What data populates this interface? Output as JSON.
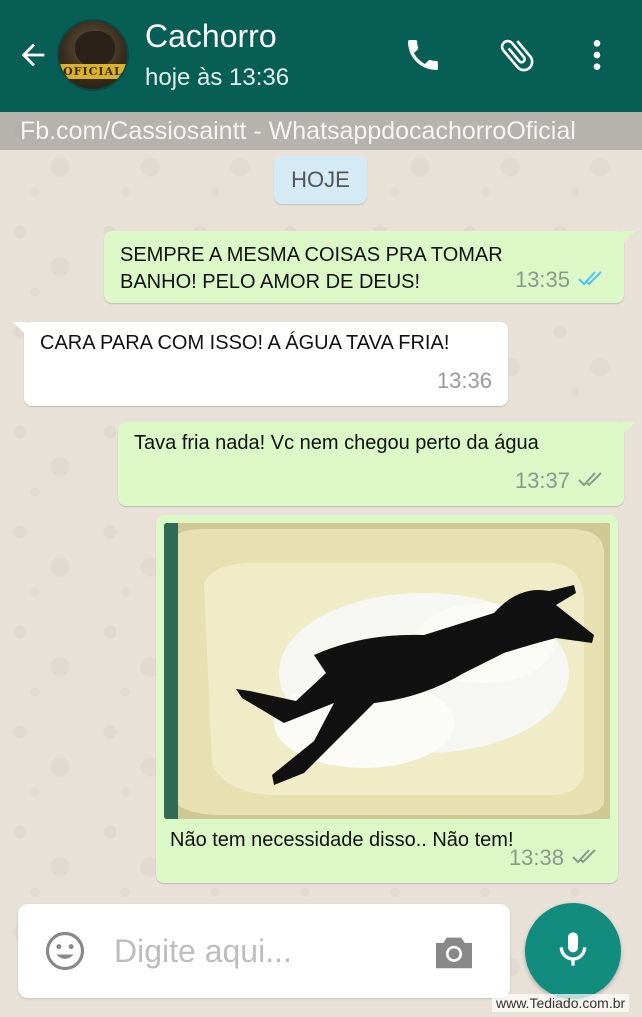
{
  "header": {
    "contact_name": "Cachorro",
    "status": "hoje às 13:36",
    "avatar_label": "OFICIAL",
    "background_color": "#075e54",
    "icons": [
      "back-arrow-icon",
      "phone-icon",
      "paperclip-icon",
      "more-vert-icon"
    ]
  },
  "watermark": {
    "text": "Fb.com/Cassiosaintt -  WhatsappdocachorroOficial"
  },
  "date_separator": {
    "label": "HOJE"
  },
  "messages": [
    {
      "direction": "outgoing",
      "lines": [
        "SEMPRE A MESMA COISAS PRA TOMAR",
        "BANHO!  PELO AMOR DE DEUS!"
      ],
      "time": "13:35",
      "status": "read",
      "status_icon": "double-check-blue-icon"
    },
    {
      "direction": "incoming",
      "lines": [
        "CARA  PARA COM ISSO!  A ÁGUA TAVA FRIA!"
      ],
      "time": "13:36"
    },
    {
      "direction": "outgoing",
      "lines": [
        "Tava fria nada!  Vc nem chegou perto da água"
      ],
      "time": "13:37",
      "status": "delivered",
      "status_icon": "double-check-gray-icon"
    },
    {
      "direction": "outgoing",
      "type": "image",
      "image_description_icon": "photo-dog-bathtub",
      "caption": "Não tem necessidade disso..  Não tem!",
      "time": "13:38",
      "status": "delivered",
      "status_icon": "double-check-gray-icon"
    }
  ],
  "composer": {
    "placeholder": "Digite aqui...",
    "icons": [
      "emoji-icon",
      "camera-icon",
      "mic-icon"
    ],
    "accent_color": "#128c7e"
  },
  "credit": {
    "text": "www.Tediado.com.br"
  },
  "colors": {
    "outgoing_bubble": "#dcf8c6",
    "incoming_bubble": "#ffffff",
    "read_tick": "#4fc3f7"
  }
}
